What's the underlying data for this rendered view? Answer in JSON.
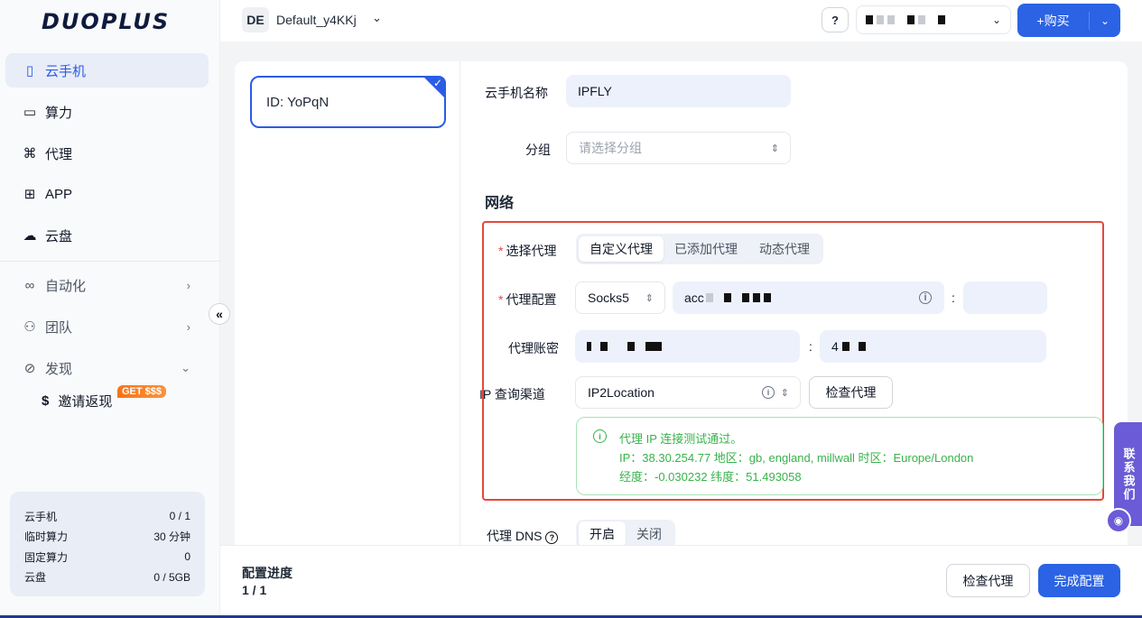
{
  "brand": {
    "logo": "DUOPLUS"
  },
  "sidebar": {
    "items": [
      {
        "label": "云手机",
        "icon": "phone-icon"
      },
      {
        "label": "算力",
        "icon": "monitor-icon"
      },
      {
        "label": "代理",
        "icon": "network-icon"
      },
      {
        "label": "APP",
        "icon": "grid-icon"
      },
      {
        "label": "云盘",
        "icon": "cloud-icon"
      },
      {
        "label": "自动化",
        "icon": "infinity-icon"
      },
      {
        "label": "团队",
        "icon": "team-icon"
      },
      {
        "label": "发现",
        "icon": "compass-icon"
      }
    ],
    "invite": {
      "label": "邀请返现",
      "badge": "GET $$$"
    },
    "stats": [
      {
        "label": "云手机",
        "value": "0 / 1"
      },
      {
        "label": "临时算力",
        "value": "30 分钟"
      },
      {
        "label": "固定算力",
        "value": "0"
      },
      {
        "label": "云盘",
        "value": "0 / 5GB"
      }
    ]
  },
  "header": {
    "workspace_initials": "DE",
    "workspace_name": "Default_y4KKj",
    "buy_label": "+购买"
  },
  "device": {
    "id_label": "ID: YoPqN"
  },
  "form": {
    "name_label": "云手机名称",
    "name_value": "IPFLY",
    "group_label": "分组",
    "group_placeholder": "请选择分组",
    "network_title": "网络",
    "proxy_select_label": "选择代理",
    "proxy_tabs": [
      "自定义代理",
      "已添加代理",
      "动态代理"
    ],
    "proxy_config_label": "代理配置",
    "proxy_protocol": "Socks5",
    "proxy_host": "acc",
    "proxy_account_label": "代理账密",
    "ip_channel_label": "IP 查询渠道",
    "ip_channel_value": "IP2Location",
    "check_proxy_button": "检查代理",
    "result": {
      "title": "代理 IP 连接测试通过。",
      "line2": "IP：38.30.254.77  地区：gb, england, millwall  时区：Europe/London",
      "line3": "经度：-0.030232  纬度：51.493058"
    },
    "dns_label": "代理 DNS",
    "dns_options": [
      "开启",
      "关闭"
    ]
  },
  "footer": {
    "progress_label": "配置进度",
    "progress_value": "1 / 1",
    "check_button": "检查代理",
    "done_button": "完成配置"
  },
  "contact": {
    "label": "联系我们"
  },
  "colors": {
    "primary": "#2b63e4",
    "success": "#37b34a",
    "highlight_border": "#e5483b"
  }
}
